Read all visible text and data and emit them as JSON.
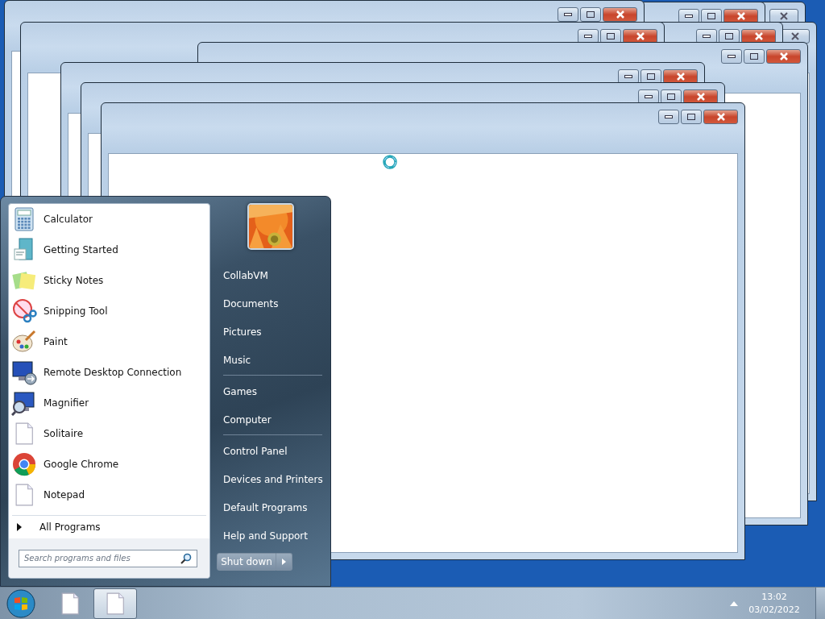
{
  "start_menu": {
    "pinned_programs": [
      {
        "label": "Calculator",
        "kind": "calculator"
      },
      {
        "label": "Getting Started",
        "kind": "getting-started"
      },
      {
        "label": "Sticky Notes",
        "kind": "sticky-notes"
      },
      {
        "label": "Snipping Tool",
        "kind": "snipping-tool"
      },
      {
        "label": "Paint",
        "kind": "paint"
      },
      {
        "label": "Remote Desktop Connection",
        "kind": "remote-desktop"
      },
      {
        "label": "Magnifier",
        "kind": "magnifier"
      },
      {
        "label": "Solitaire",
        "kind": "document"
      },
      {
        "label": "Google Chrome",
        "kind": "chrome"
      },
      {
        "label": "Notepad",
        "kind": "document"
      }
    ],
    "all_programs": {
      "label": "All Programs"
    },
    "search": {
      "placeholder": "Search programs and files"
    },
    "place_groups": [
      {
        "items": [
          {
            "label": "CollabVM"
          },
          {
            "label": "Documents"
          },
          {
            "label": "Pictures"
          },
          {
            "label": "Music"
          }
        ]
      },
      {
        "items": [
          {
            "label": "Games"
          },
          {
            "label": "Computer"
          }
        ]
      },
      {
        "items": [
          {
            "label": "Control Panel"
          },
          {
            "label": "Devices and Printers"
          },
          {
            "label": "Default Programs"
          },
          {
            "label": "Help and Support"
          }
        ]
      }
    ],
    "shutdown": {
      "label": "Shut down"
    }
  },
  "taskbar": {
    "items": [
      {
        "kind": "document",
        "selected": false
      },
      {
        "kind": "document",
        "selected": true
      }
    ],
    "clock": {
      "time": "13:02",
      "date": "03/02/2022"
    }
  }
}
